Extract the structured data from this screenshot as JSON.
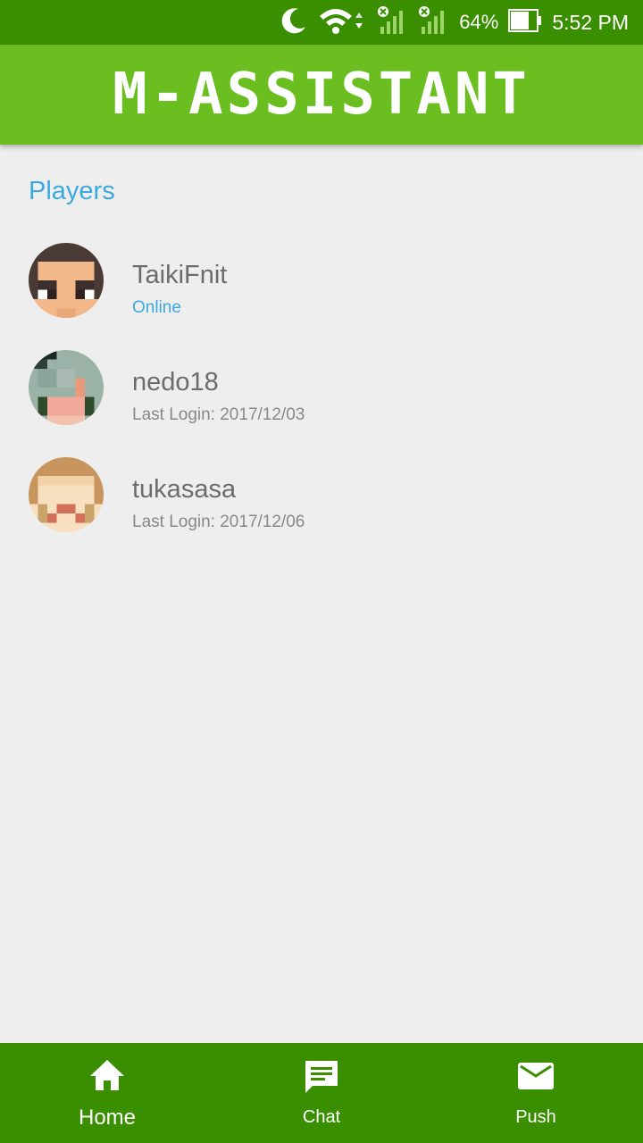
{
  "status_bar": {
    "icons": [
      "moon-icon",
      "wifi-icon",
      "signal-icon",
      "signal-icon",
      "battery-icon"
    ],
    "battery": "64%",
    "time": "5:52 PM"
  },
  "app": {
    "title": "M-ASSISTANT"
  },
  "section": {
    "title": "Players"
  },
  "players": [
    {
      "name": "TaikiFnit",
      "status": "Online",
      "online": true,
      "avatar": "avatar-taikifnit"
    },
    {
      "name": "nedo18",
      "status": "Last Login: 2017/12/03",
      "online": false,
      "avatar": "avatar-nedo18"
    },
    {
      "name": "tukasasa",
      "status": "Last Login: 2017/12/06",
      "online": false,
      "avatar": "avatar-tukasasa"
    }
  ],
  "nav": {
    "items": [
      {
        "label": "Home",
        "icon": "home-icon",
        "active": true
      },
      {
        "label": "Chat",
        "icon": "chat-icon",
        "active": false
      },
      {
        "label": "Push",
        "icon": "mail-icon",
        "active": false
      }
    ]
  },
  "colors": {
    "status_bar": "#3a8f00",
    "app_bar": "#6abe1f",
    "bottom_nav": "#3a8f00",
    "accent": "#3ba9e0",
    "background": "#eeeeee"
  }
}
